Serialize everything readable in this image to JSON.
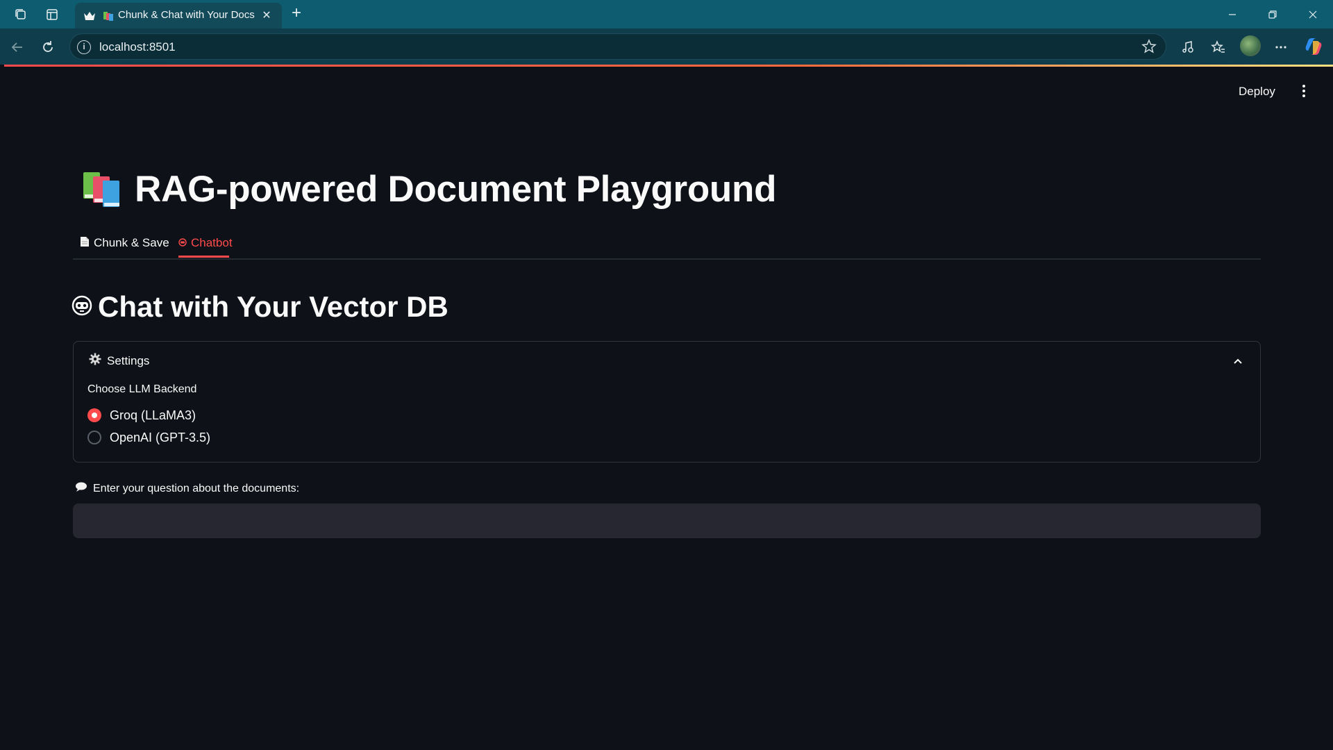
{
  "browser": {
    "tab_title": "Chunk & Chat with Your Docs",
    "url": "localhost:8501"
  },
  "app": {
    "deploy_label": "Deploy",
    "title": "RAG-powered Document Playground",
    "tabs": [
      {
        "label": "Chunk & Save",
        "icon": "page-icon",
        "active": false
      },
      {
        "label": "Chatbot",
        "icon": "robot-icon",
        "active": true
      }
    ],
    "section_title": "Chat with Your Vector DB",
    "settings": {
      "label": "Settings",
      "radio_label": "Choose LLM Backend",
      "options": [
        {
          "label": "Groq (LLaMA3)",
          "selected": true
        },
        {
          "label": "OpenAI (GPT-3.5)",
          "selected": false
        }
      ]
    },
    "question": {
      "label": "Enter your question about the documents:",
      "value": ""
    }
  },
  "colors": {
    "accent": "#ff4b4b",
    "background": "#0e1117",
    "input_bg": "#262730",
    "tabstrip": "#0d5c70"
  }
}
